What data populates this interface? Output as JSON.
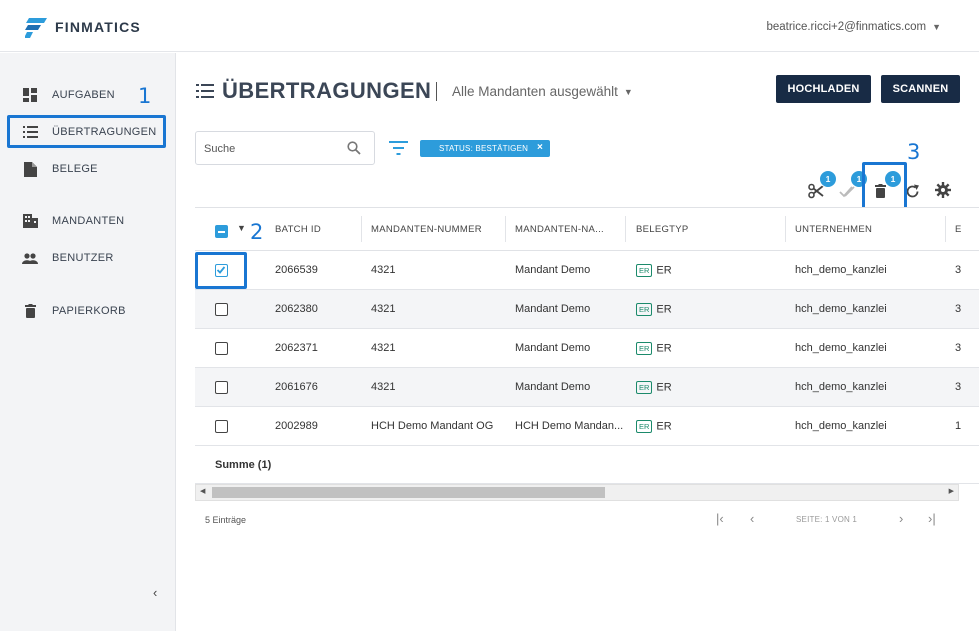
{
  "app": {
    "brand": "FINMATICS"
  },
  "user_menu": {
    "email": "beatrice.ricci+2@finmatics.com"
  },
  "sidebar": {
    "items": [
      {
        "label": "AUFGABEN",
        "icon": "dashboard-icon"
      },
      {
        "label": "ÜBERTRAGUNGEN",
        "icon": "list-icon"
      },
      {
        "label": "BELEGE",
        "icon": "document-icon"
      },
      {
        "label": "MANDANTEN",
        "icon": "building-icon"
      },
      {
        "label": "BENUTZER",
        "icon": "people-icon"
      },
      {
        "label": "PAPIERKORB",
        "icon": "trash-icon"
      }
    ],
    "collapse_label": "‹"
  },
  "header": {
    "title": "ÜBERTRAGUNGEN",
    "mandant_select": "Alle Mandanten ausgewählt",
    "upload_label": "HOCHLADEN",
    "scan_label": "SCANNEN"
  },
  "search": {
    "placeholder": "Suche"
  },
  "filter_chip": {
    "label": "STATUS: BESTÄTIGEN",
    "remove": "×"
  },
  "toolbar": {
    "badges": {
      "split": "1",
      "approve": "1",
      "delete": "1"
    }
  },
  "annotations": {
    "n1": "1",
    "n2": "2",
    "n3": "3"
  },
  "table": {
    "columns": [
      "BATCH ID",
      "MANDANTEN-NUMMER",
      "MANDANTEN-NA...",
      "BELEGTYP",
      "UNTERNEHMEN",
      "E"
    ],
    "rows": [
      {
        "batch_id": "2066539",
        "mandant_nr": "4321",
        "mandant_name": "Mandant Demo",
        "tag": "ER",
        "belegtyp": "ER",
        "unternehmen": "hch_demo_kanzlei",
        "extra": "3",
        "checked": true
      },
      {
        "batch_id": "2062380",
        "mandant_nr": "4321",
        "mandant_name": "Mandant Demo",
        "tag": "ER",
        "belegtyp": "ER",
        "unternehmen": "hch_demo_kanzlei",
        "extra": "3",
        "checked": false
      },
      {
        "batch_id": "2062371",
        "mandant_nr": "4321",
        "mandant_name": "Mandant Demo",
        "tag": "ER",
        "belegtyp": "ER",
        "unternehmen": "hch_demo_kanzlei",
        "extra": "3",
        "checked": false
      },
      {
        "batch_id": "2061676",
        "mandant_nr": "4321",
        "mandant_name": "Mandant Demo",
        "tag": "ER",
        "belegtyp": "ER",
        "unternehmen": "hch_demo_kanzlei",
        "extra": "3",
        "checked": false
      },
      {
        "batch_id": "2002989",
        "mandant_nr": "HCH Demo Mandant OG",
        "mandant_name": "HCH Demo Mandan...",
        "tag": "ER",
        "belegtyp": "ER",
        "unternehmen": "hch_demo_kanzlei",
        "extra": "1",
        "checked": false
      }
    ],
    "summary": "Summe (1)"
  },
  "pager": {
    "entries": "5 Einträge",
    "page_text": "SEITE: 1 VON 1"
  },
  "colors": {
    "accent": "#2d9cdb",
    "dark_button": "#182b45",
    "annotation": "#1976d2"
  }
}
